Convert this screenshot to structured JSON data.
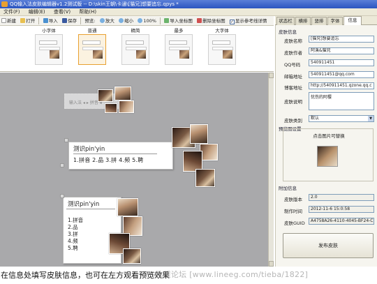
{
  "window": {
    "title": "QQ输入法皮肤编辑器v1.2测试版 -- D:\\skin王朝\\卡通\\[猫兄]想要追忘.qpys *"
  },
  "menu": [
    "文件(F)",
    "编辑(E)",
    "查看(V)",
    "帮助(H)"
  ],
  "toolbar": {
    "new": "新建",
    "open": "打开",
    "import": "导入",
    "save": "保存",
    "preview_label": "预览:",
    "zoom_in": "放大",
    "zoom_out": "缩小",
    "zoom_100": "100%",
    "import_coords": "导入坐标图",
    "delete_coords": "删除坐标图",
    "show_ref": "显示参考线详情",
    "show_ref_checked": "✓"
  },
  "sizes": [
    {
      "label": "小字体"
    },
    {
      "label": "普通"
    },
    {
      "label": "精简"
    },
    {
      "label": "最多"
    },
    {
      "label": "大字体"
    }
  ],
  "canvas": {
    "faint_candidate": "输入法 ◂ ▸ 拼音 ◂",
    "candidate_h_comp": "测识pin'yin",
    "candidate_h_list": "1.拼音  2.品  3.拼  4.频  5.聘",
    "candidate_v_comp": "测识pin'yin",
    "candidate_v_list": [
      "1.拼音",
      "2.品",
      "3.拼",
      "4.频",
      "5.聘"
    ]
  },
  "tabs": [
    "状态栏",
    "横排",
    "竖排",
    "字体",
    "信息"
  ],
  "info": {
    "skin_group": "皮肤信息",
    "name_label": "皮肤名称",
    "name_value": "[猫兄]想要追忘",
    "author_label": "皮肤作者",
    "author_value": "阿溪&猫兄",
    "qq_label": "QQ号码",
    "qq_value": "540911451",
    "email_label": "邮箱地址",
    "email_value": "540911451@qq.com",
    "blog_label": "博客地址",
    "blog_value": "http://540911451.qzone.qq.c",
    "desc_label": "皮肤说明",
    "desc_value": "忧伤的阿樱",
    "type_label": "皮肤类别",
    "type_value": "默认",
    "preview_group": "预览图设置",
    "preview_hint": "点击图片可替换",
    "extra_group": "附加信息",
    "version_label": "皮肤版本",
    "version_value": "2.0",
    "time_label": "制作时间",
    "time_value": "2012-11-6 15:0:58",
    "guid_label": "皮肤GUID",
    "guid_value": "A4758A26-4110-4045-BF24-C78",
    "publish": "发布皮肤"
  },
  "caption": {
    "text": "在信息处填写皮肤信息，也可在左方观看预览效果",
    "watermark": "PS教程论坛  [www.lineeg.com/tieba/1822]"
  },
  "colors": {
    "titlebar": "#2b55c0",
    "canvas": "#a9a9ab",
    "selected_size": "#e8a030"
  }
}
